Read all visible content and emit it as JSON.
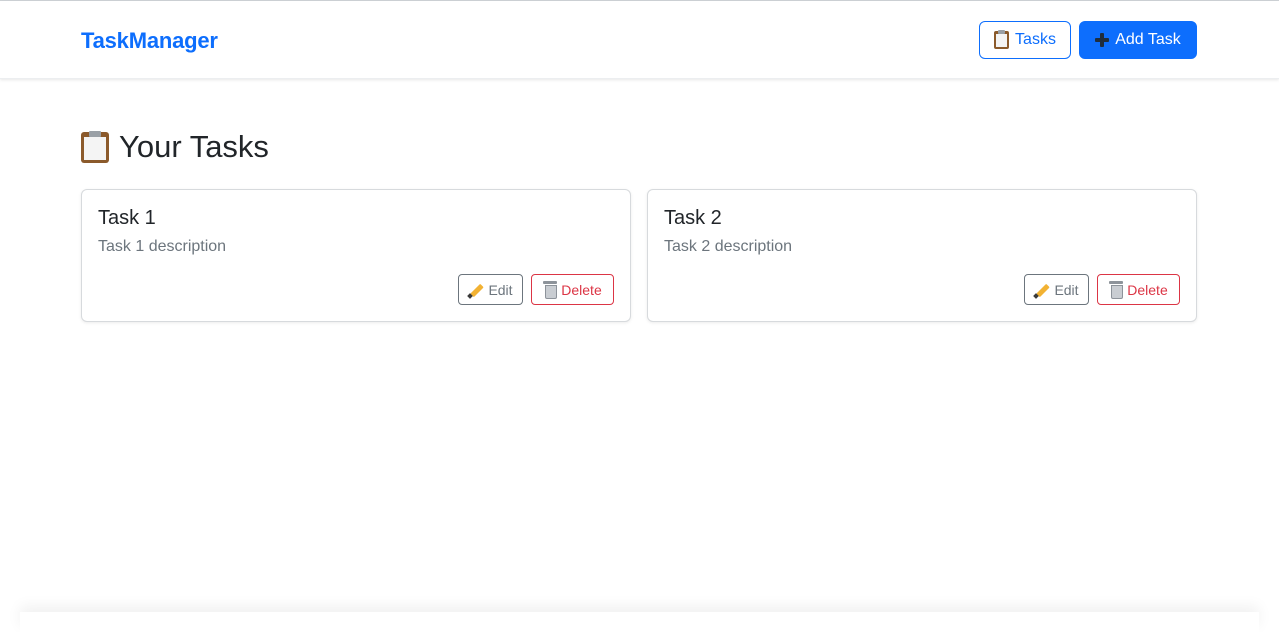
{
  "navbar": {
    "brand": "TaskManager",
    "tasks_button_label": "Tasks",
    "add_task_button_label": "Add Task",
    "tasks_icon": "clipboard-icon",
    "add_icon": "plus-icon"
  },
  "main": {
    "title": "Your Tasks",
    "title_icon": "clipboard-icon",
    "tasks": [
      {
        "title": "Task 1",
        "description": "Task 1 description",
        "edit_label": "Edit",
        "delete_label": "Delete"
      },
      {
        "title": "Task 2",
        "description": "Task 2 description",
        "edit_label": "Edit",
        "delete_label": "Delete"
      }
    ]
  },
  "colors": {
    "primary": "#0d6efd",
    "secondary": "#6c757d",
    "danger": "#dc3545",
    "text": "#212529"
  }
}
